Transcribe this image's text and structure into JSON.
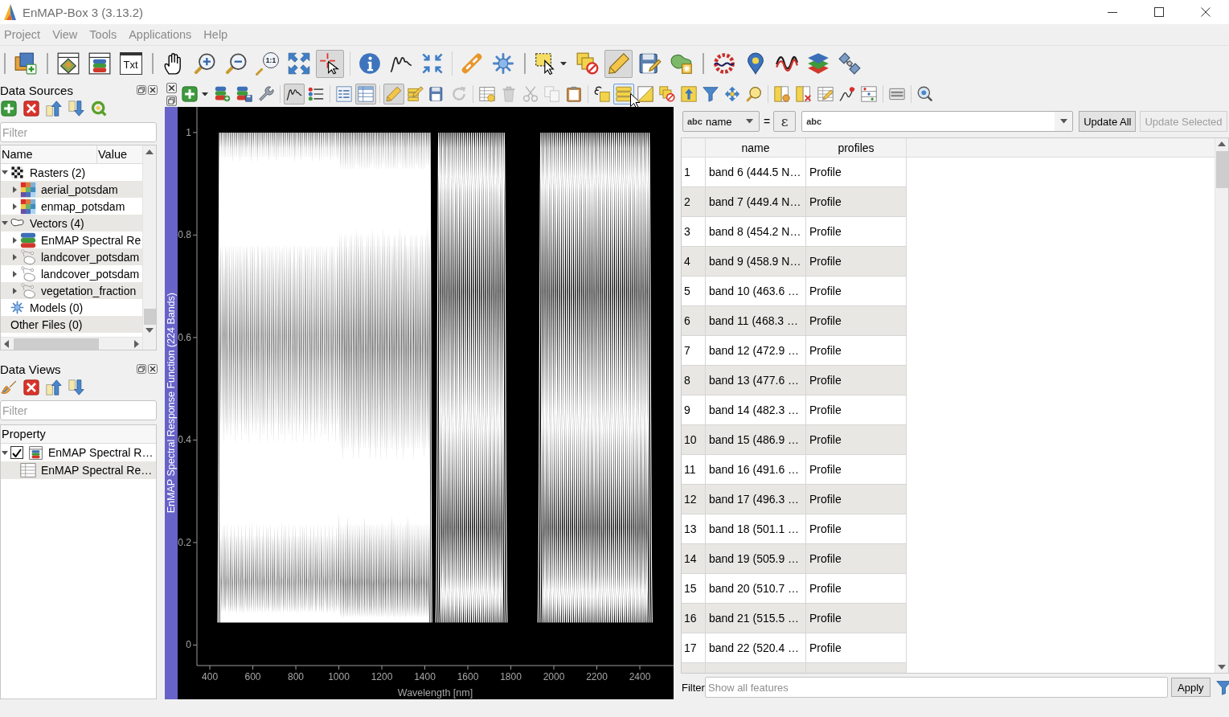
{
  "window": {
    "title": "EnMAP-Box 3 (3.13.2)"
  },
  "menu": [
    "Project",
    "View",
    "Tools",
    "Applications",
    "Help"
  ],
  "main_toolbar": {
    "toolbars": [
      {
        "groups": [
          {
            "buttons": [
              {
                "kind": "adddata",
                "pressed": false
              }
            ]
          }
        ]
      },
      {
        "groups": [
          {
            "buttons": [
              {
                "kind": "mapwindow",
                "pressed": false
              },
              {
                "kind": "speclibwindow",
                "pressed": false
              },
              {
                "kind": "textwindow",
                "label": "Txt",
                "pressed": false
              }
            ]
          }
        ]
      },
      {
        "groups": [
          {
            "buttons": [
              {
                "kind": "hand",
                "pressed": false
              },
              {
                "kind": "zoomin",
                "pressed": false
              },
              {
                "kind": "zoomout",
                "pressed": false
              },
              {
                "kind": "zoomnative",
                "label": "1:1",
                "pressed": false
              },
              {
                "kind": "zoomfull",
                "pressed": false
              },
              {
                "kind": "select",
                "pressed": true
              }
            ]
          },
          {
            "buttons": [
              {
                "kind": "info",
                "pressed": false
              },
              {
                "kind": "profile",
                "pressed": false
              },
              {
                "kind": "pan",
                "pressed": false
              }
            ]
          },
          {
            "buttons": [
              {
                "kind": "link",
                "pressed": false
              },
              {
                "kind": "gear",
                "pressed": false
              }
            ]
          }
        ]
      },
      {
        "groups": [
          {
            "buttons": [
              {
                "kind": "selectrect",
                "pressed": false,
                "menu": true
              },
              {
                "kind": "deselect",
                "pressed": false
              },
              {
                "kind": "edit",
                "pressed": true
              },
              {
                "kind": "saveedits",
                "pressed": false
              },
              {
                "kind": "addfeature",
                "pressed": false
              }
            ]
          }
        ]
      },
      {
        "groups": [
          {
            "buttons": [
              {
                "kind": "processing",
                "pressed": false
              },
              {
                "kind": "pin",
                "pressed": false
              },
              {
                "kind": "wave",
                "pressed": false
              },
              {
                "kind": "layers",
                "pressed": false
              },
              {
                "kind": "satellite",
                "pressed": false
              }
            ]
          }
        ]
      }
    ]
  },
  "data_sources": {
    "title": "Data Sources",
    "filter": {
      "placeholder": "Filter"
    },
    "columns": [
      "Name",
      "Value"
    ],
    "tree": [
      {
        "label": "Rasters (2)",
        "kind": "rasters",
        "expanded": true,
        "children": [
          {
            "label": "aerial_potsdam",
            "kind": "raster",
            "expanded": false
          },
          {
            "label": "enmap_potsdam",
            "kind": "raster",
            "expanded": false
          }
        ]
      },
      {
        "label": "Vectors (4)",
        "kind": "vectors",
        "expanded": true,
        "children": [
          {
            "label": "EnMAP Spectral Re",
            "kind": "speclib",
            "expanded": false
          },
          {
            "label": "landcover_potsdam",
            "kind": "vector",
            "expanded": false
          },
          {
            "label": "landcover_potsdam",
            "kind": "vector",
            "expanded": false
          },
          {
            "label": "vegetation_fraction",
            "kind": "vector",
            "expanded": false
          }
        ]
      },
      {
        "label": "Models (0)",
        "kind": "models"
      },
      {
        "label": "Other Files (0)",
        "kind": "files"
      }
    ]
  },
  "data_views": {
    "title": "Data Views",
    "filter": {
      "placeholder": "Filter"
    },
    "columns": [
      "Property"
    ],
    "tree": [
      {
        "label": "EnMAP Spectral R…",
        "kind": "speclibview",
        "expanded": true,
        "checked": true,
        "children": [
          {
            "label": "EnMAP Spectral Re…",
            "kind": "attributes"
          }
        ]
      }
    ]
  },
  "spectral_library": {
    "dock_title": "EnMAP Spectral Response Function (224 Bands)",
    "toolbar": {
      "groups": [
        {
          "buttons": [
            {
              "kind": "add",
              "menu": true,
              "pressed": false,
              "disabled": false,
              "hovered": false
            },
            {
              "kind": "dbadd",
              "pressed": false,
              "disabled": false,
              "hovered": false
            },
            {
              "kind": "dbsave",
              "pressed": false,
              "disabled": false,
              "hovered": false
            },
            {
              "kind": "wrench",
              "pressed": false,
              "disabled": false,
              "hovered": false
            }
          ]
        },
        {
          "buttons": [
            {
              "kind": "curve",
              "pressed": true,
              "disabled": false,
              "hovered": false
            },
            {
              "kind": "legend",
              "pressed": false,
              "disabled": false,
              "hovered": false
            }
          ]
        },
        {
          "buttons": [
            {
              "kind": "formview",
              "pressed": false,
              "disabled": false,
              "hovered": false
            },
            {
              "kind": "tableview",
              "pressed": true,
              "disabled": false,
              "hovered": false
            }
          ]
        },
        {
          "buttons": [
            {
              "kind": "edit",
              "pressed": true,
              "disabled": false,
              "hovered": false
            },
            {
              "kind": "multiedit",
              "pressed": false,
              "disabled": false,
              "hovered": false
            },
            {
              "kind": "save",
              "pressed": false,
              "disabled": false,
              "hovered": false
            },
            {
              "kind": "refresh",
              "pressed": false,
              "disabled": true,
              "hovered": false
            }
          ]
        },
        {
          "buttons": [
            {
              "kind": "newrow",
              "pressed": false,
              "disabled": false,
              "hovered": false
            },
            {
              "kind": "delete",
              "pressed": false,
              "disabled": true,
              "hovered": false
            },
            {
              "kind": "cut",
              "pressed": false,
              "disabled": true,
              "hovered": false
            },
            {
              "kind": "copy",
              "pressed": false,
              "disabled": true,
              "hovered": false
            },
            {
              "kind": "paste",
              "pressed": false,
              "disabled": false,
              "hovered": false
            }
          ]
        },
        {
          "buttons": [
            {
              "kind": "exprselect",
              "pressed": false,
              "disabled": false,
              "hovered": false
            },
            {
              "kind": "selectall",
              "pressed": false,
              "disabled": false,
              "hovered": true
            },
            {
              "kind": "invert",
              "pressed": false,
              "disabled": false,
              "hovered": false
            },
            {
              "kind": "deselect",
              "pressed": false,
              "disabled": false,
              "hovered": false
            },
            {
              "kind": "movetop",
              "pressed": false,
              "disabled": false,
              "hovered": false
            },
            {
              "kind": "filter",
              "pressed": false,
              "disabled": false,
              "hovered": false
            },
            {
              "kind": "pansel",
              "pressed": false,
              "disabled": false,
              "hovered": false
            },
            {
              "kind": "zoomsel",
              "pressed": false,
              "disabled": false,
              "hovered": false
            }
          ]
        },
        {
          "buttons": [
            {
              "kind": "addcol",
              "pressed": false,
              "disabled": false,
              "hovered": false
            },
            {
              "kind": "delcol",
              "pressed": false,
              "disabled": false,
              "hovered": false
            },
            {
              "kind": "fieldcalc",
              "pressed": false,
              "disabled": false,
              "hovered": false
            },
            {
              "kind": "spark",
              "pressed": false,
              "disabled": false,
              "hovered": false
            },
            {
              "kind": "calculator",
              "pressed": false,
              "disabled": false,
              "hovered": false
            }
          ]
        },
        {
          "buttons": [
            {
              "kind": "dock",
              "pressed": false,
              "disabled": false,
              "hovered": false
            }
          ]
        },
        {
          "buttons": [
            {
              "kind": "searchsettings",
              "pressed": false,
              "disabled": false,
              "hovered": false
            }
          ]
        }
      ]
    },
    "chart_data": {
      "type": "line",
      "xlabel": "Wavelength [nm]",
      "xlim": [
        340,
        2557
      ],
      "ylim": [
        -0.04,
        1.05
      ],
      "xticks": [
        400,
        600,
        800,
        1000,
        1200,
        1400,
        1600,
        1800,
        2000,
        2200,
        2400
      ],
      "yticks": [
        {
          "value": 0,
          "label": "0"
        },
        {
          "value": 0.2,
          "label": "0.2"
        },
        {
          "value": 0.4,
          "label": "0.4"
        },
        {
          "value": 0.6,
          "label": "0.6"
        },
        {
          "value": 0.8,
          "label": "0.8"
        },
        {
          "value": 1,
          "label": "1"
        }
      ]
    },
    "expression_bar": {
      "field": {
        "type_label": "abc",
        "label": "name"
      },
      "equals": "=",
      "expression_button": "ε",
      "value": {
        "type_label": "abc"
      }
    },
    "update_buttons": [
      {
        "label": "Update All",
        "disabled": false
      },
      {
        "label": "Update Selected",
        "disabled": true
      }
    ],
    "table": {
      "columns": [
        "name",
        "profiles"
      ],
      "rows": [
        {
          "number": "1",
          "name": "band 6 (444.5 N…",
          "profiles": "Profile"
        },
        {
          "number": "2",
          "name": "band 7 (449.4 N…",
          "profiles": "Profile"
        },
        {
          "number": "3",
          "name": "band 8 (454.2 N…",
          "profiles": "Profile"
        },
        {
          "number": "4",
          "name": "band 9 (458.9 N…",
          "profiles": "Profile"
        },
        {
          "number": "5",
          "name": "band 10 (463.6 …",
          "profiles": "Profile"
        },
        {
          "number": "6",
          "name": "band 11 (468.3 …",
          "profiles": "Profile"
        },
        {
          "number": "7",
          "name": "band 12 (472.9 …",
          "profiles": "Profile"
        },
        {
          "number": "8",
          "name": "band 13 (477.6 …",
          "profiles": "Profile"
        },
        {
          "number": "9",
          "name": "band 14 (482.3 …",
          "profiles": "Profile"
        },
        {
          "number": "10",
          "name": "band 15 (486.9 …",
          "profiles": "Profile"
        },
        {
          "number": "11",
          "name": "band 16 (491.6 …",
          "profiles": "Profile"
        },
        {
          "number": "12",
          "name": "band 17 (496.3 …",
          "profiles": "Profile"
        },
        {
          "number": "13",
          "name": "band 18 (501.1 …",
          "profiles": "Profile"
        },
        {
          "number": "14",
          "name": "band 19 (505.9 …",
          "profiles": "Profile"
        },
        {
          "number": "15",
          "name": "band 20 (510.7 …",
          "profiles": "Profile"
        },
        {
          "number": "16",
          "name": "band 21 (515.5 …",
          "profiles": "Profile"
        },
        {
          "number": "17",
          "name": "band 22 (520.4 …",
          "profiles": "Profile"
        }
      ]
    },
    "filter": {
      "label": "Filter",
      "placeholder": "Show all features",
      "button": "Apply"
    }
  }
}
